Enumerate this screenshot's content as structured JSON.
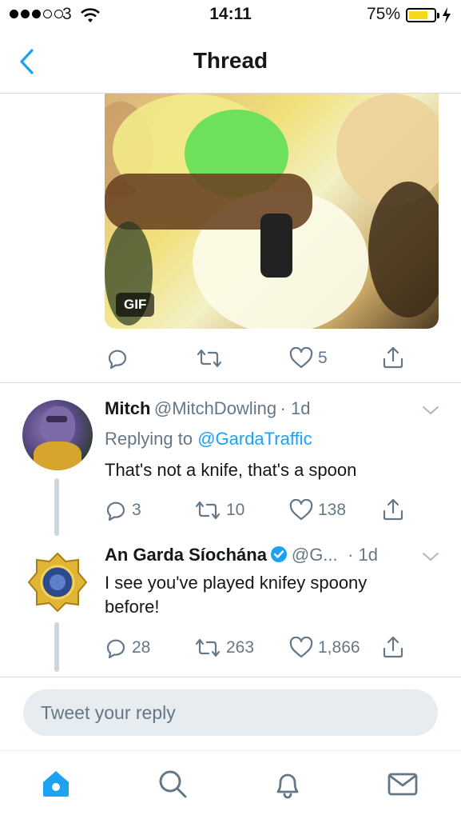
{
  "status_bar": {
    "carrier": "3",
    "time": "14:11",
    "battery": "75%"
  },
  "nav": {
    "title": "Thread"
  },
  "gif_tweet": {
    "badge": "GIF",
    "actions": {
      "reply": "",
      "retweet": "",
      "like": "5"
    }
  },
  "reply1": {
    "name": "Mitch",
    "handle": "@MitchDowling",
    "time": "· 1d",
    "replying_prefix": "Replying to ",
    "replying_to": "@GardaTraffic",
    "text": "That's not a knife, that's a spoon",
    "actions": {
      "reply": "3",
      "retweet": "10",
      "like": "138"
    }
  },
  "reply2": {
    "name": "An Garda Síochána",
    "handle": "@G...",
    "time": "· 1d",
    "text_line1": "I see you've played knifey spoony",
    "text_line2": "before!",
    "actions": {
      "reply": "28",
      "retweet": "263",
      "like": "1,866"
    }
  },
  "reply_box": {
    "placeholder": "Tweet your reply"
  },
  "colors": {
    "accent": "#1da1f2",
    "muted": "#657786",
    "divider": "#d6dbdf"
  },
  "tab_bar": [
    "home-icon",
    "search-icon",
    "notifications-icon",
    "messages-icon"
  ]
}
